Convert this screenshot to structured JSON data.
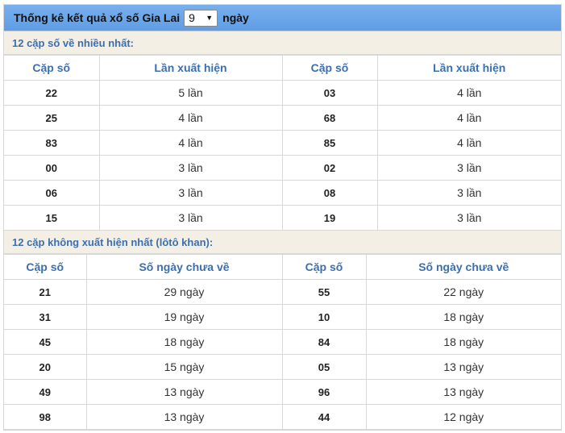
{
  "header": {
    "title_prefix": "Thống kê kết quả xổ số Gia Lai",
    "days_value": "9",
    "title_suffix": "ngày"
  },
  "section1": {
    "title": "12 cặp số về nhiều nhất:",
    "col_pair": "Cặp số",
    "col_count": "Lần xuất hiện",
    "rows": [
      {
        "a": "22",
        "a_val": "5 lần",
        "b": "03",
        "b_val": "4 lần"
      },
      {
        "a": "25",
        "a_val": "4 lần",
        "b": "68",
        "b_val": "4 lần"
      },
      {
        "a": "83",
        "a_val": "4 lần",
        "b": "85",
        "b_val": "4 lần"
      },
      {
        "a": "00",
        "a_val": "3 lần",
        "b": "02",
        "b_val": "3 lần"
      },
      {
        "a": "06",
        "a_val": "3 lần",
        "b": "08",
        "b_val": "3 lần"
      },
      {
        "a": "15",
        "a_val": "3 lần",
        "b": "19",
        "b_val": "3 lần"
      }
    ]
  },
  "section2": {
    "title": "12 cặp không xuất hiện nhất (lôtô khan):",
    "col_pair": "Cặp số",
    "col_days": "Số ngày chưa về",
    "rows": [
      {
        "a": "21",
        "a_val": "29 ngày",
        "b": "55",
        "b_val": "22 ngày"
      },
      {
        "a": "31",
        "a_val": "19 ngày",
        "b": "10",
        "b_val": "18 ngày"
      },
      {
        "a": "45",
        "a_val": "18 ngày",
        "b": "84",
        "b_val": "18 ngày"
      },
      {
        "a": "20",
        "a_val": "15 ngày",
        "b": "05",
        "b_val": "13 ngày"
      },
      {
        "a": "49",
        "a_val": "13 ngày",
        "b": "96",
        "b_val": "13 ngày"
      },
      {
        "a": "98",
        "a_val": "13 ngày",
        "b": "44",
        "b_val": "12 ngày"
      }
    ]
  }
}
